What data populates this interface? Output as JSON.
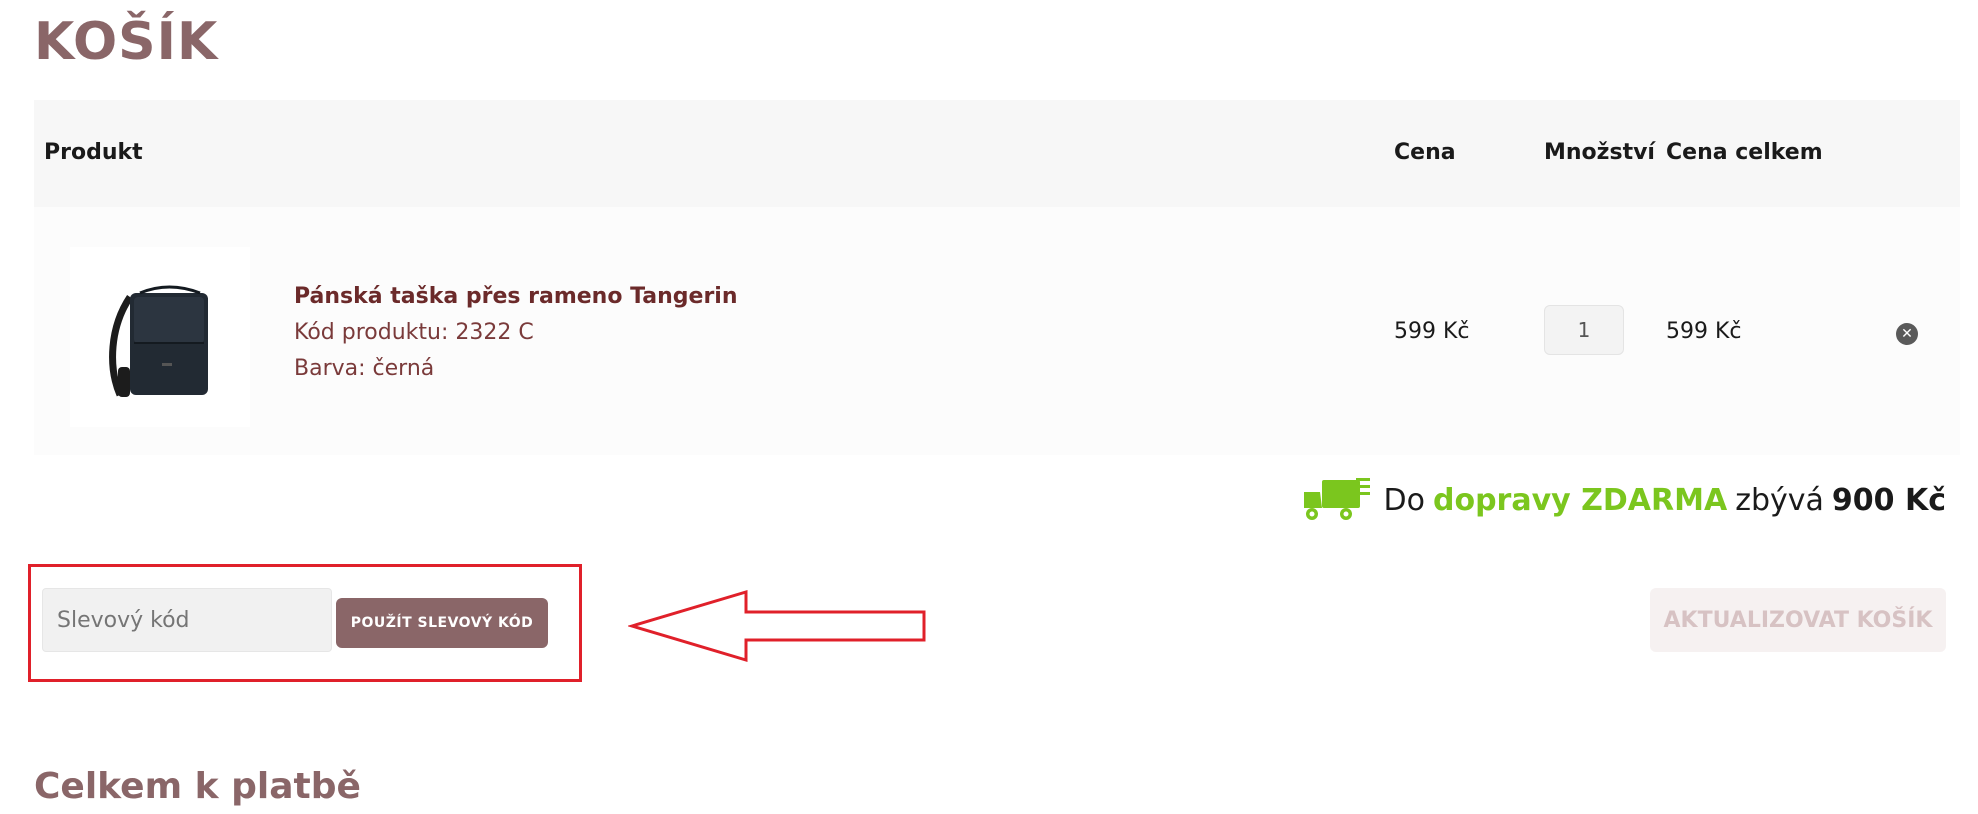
{
  "page": {
    "title": "KOŠÍK"
  },
  "cart": {
    "headers": {
      "product": "Produkt",
      "price": "Cena",
      "quantity": "Množství",
      "total": "Cena celkem"
    },
    "items": [
      {
        "name": "Pánská taška přes rameno Tangerin",
        "code": "Kód produktu: 2322 C",
        "color": "Barva: černá",
        "price": "599 Kč",
        "quantity": "1",
        "total": "599 Kč",
        "remove_icon": "close-circle-icon"
      }
    ]
  },
  "shipping": {
    "prefix": "Do",
    "highlight": "dopravy ZDARMA",
    "middle": "zbývá",
    "amount": "900 Kč",
    "icon": "delivery-truck-icon",
    "color": "#7bc61e"
  },
  "coupon": {
    "placeholder": "Slevový kód",
    "apply_label": "POUŽÍT SLEVOVÝ KÓD"
  },
  "actions": {
    "update_label": "AKTUALIZOVAT KOŠÍK"
  },
  "summary": {
    "title": "Celkem k platbě"
  },
  "colors": {
    "brand": "#8a6668",
    "highlight_border": "#e0202a"
  }
}
